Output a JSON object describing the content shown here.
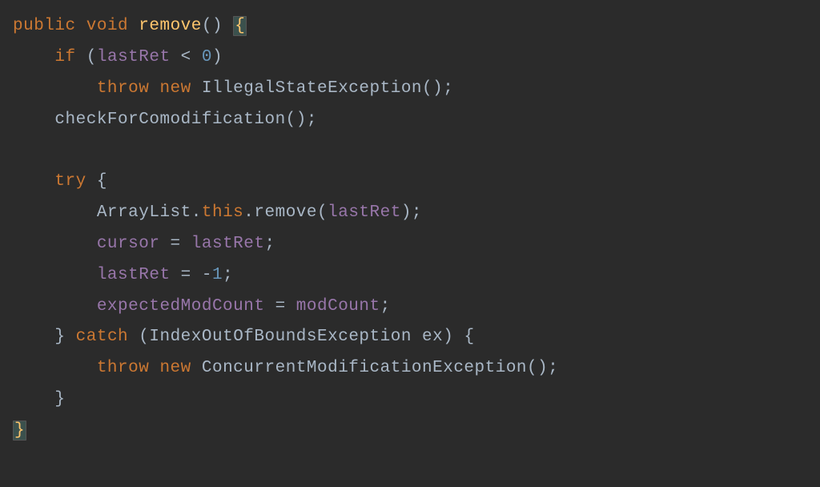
{
  "line1": {
    "public": "public",
    "void": "void",
    "method": "remove",
    "parens": "()",
    "brace": "{"
  },
  "line2": {
    "if": "if",
    "open": "(",
    "lastRet": "lastRet",
    "lt": " < ",
    "zero": "0",
    "close": ")"
  },
  "line3": {
    "throw": "throw",
    "new": "new",
    "exc": "IllegalStateException",
    "tail": "();"
  },
  "line4": {
    "call": "checkForComodification();"
  },
  "line6": {
    "try": "try",
    "brace": " {"
  },
  "line7": {
    "arraylist": "ArrayList",
    "dot1": ".",
    "this": "this",
    "dot2": ".",
    "remove": "remove(",
    "lastRet": "lastRet",
    "close": ");"
  },
  "line8": {
    "cursor": "cursor",
    "eq": " = ",
    "lastRet": "lastRet",
    "semi": ";"
  },
  "line9": {
    "lastRet": "lastRet",
    "eq": " = -",
    "one": "1",
    "semi": ";"
  },
  "line10": {
    "emc": "expectedModCount",
    "eq": " = ",
    "mc": "modCount",
    "semi": ";"
  },
  "line11": {
    "close": "}",
    "catch": "catch",
    "open": " (",
    "exc": "IndexOutOfBoundsException ex",
    "closep": ") {"
  },
  "line12": {
    "throw": "throw",
    "new": "new",
    "exc": "ConcurrentModificationException",
    "tail": "();"
  },
  "line13": {
    "close": "}"
  },
  "line14": {
    "close": "}"
  }
}
